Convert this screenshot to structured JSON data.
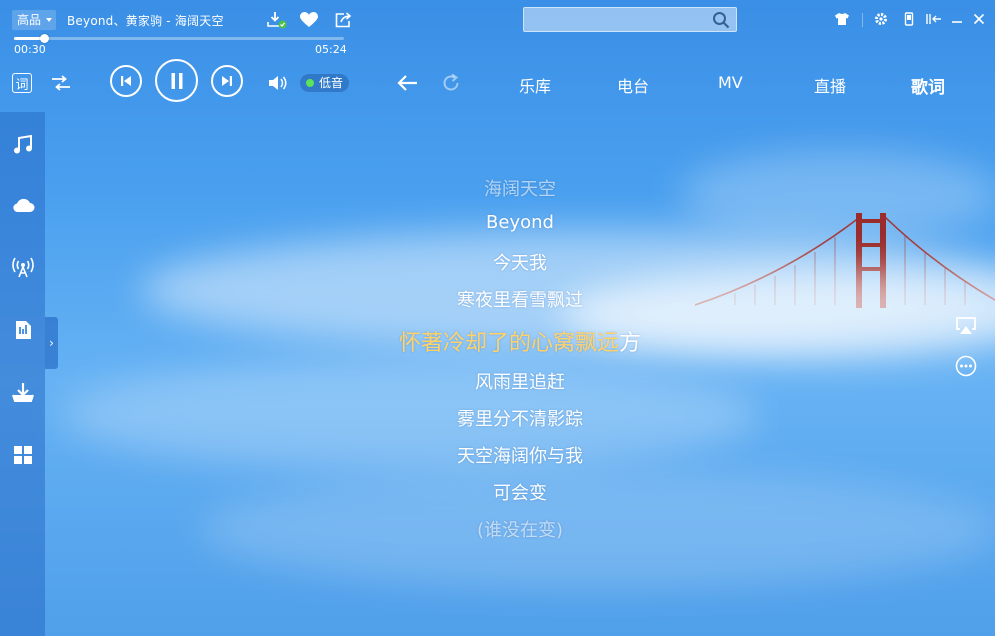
{
  "player": {
    "quality": "高品",
    "song_title": "Beyond、黄家驹 - 海阔天空",
    "current_time": "00:30",
    "total_time": "05:24",
    "progress": 0.093,
    "low_sound_label": "低音"
  },
  "search": {
    "placeholder": ""
  },
  "lyrics_toggle": "词",
  "nav": {
    "tabs": [
      {
        "label": "乐库"
      },
      {
        "label": "电台"
      },
      {
        "label": "MV"
      },
      {
        "label": "直播"
      },
      {
        "label": "歌词"
      }
    ],
    "active_tab": "歌词"
  },
  "lyrics": {
    "lines": [
      "海阔天空",
      "Beyond",
      "今天我",
      "寒夜里看雪飘过",
      "风雨里追赶",
      "雾里分不清影踪",
      "天空海阔你与我",
      "可会变",
      "(谁没在变)"
    ],
    "current_sung": "怀著冷却了的心窝飘远",
    "current_rest": "方"
  },
  "colors": {
    "accent": "#ffd36a",
    "background": "#4aa0ef",
    "low_sound_dot": "#5ce35c"
  },
  "icons": {
    "sidebar": [
      "music-note-icon",
      "cloud-icon",
      "radio-icon",
      "playlist-icon",
      "download-icon",
      "apps-grid-icon"
    ],
    "window": [
      "skin-icon",
      "settings-icon",
      "mobile-icon",
      "mini-mode-icon",
      "minimize-icon",
      "close-icon"
    ]
  }
}
